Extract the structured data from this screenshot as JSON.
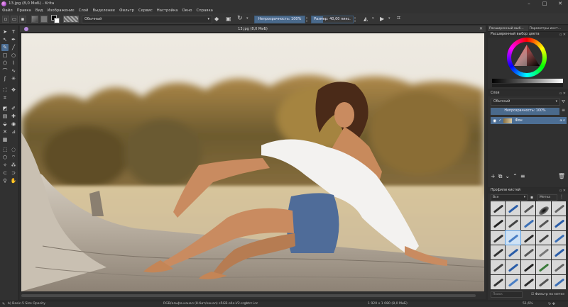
{
  "window": {
    "title": "13.jpg (8,0 МиБ) - Krita",
    "controls": [
      "–",
      "□",
      "✕"
    ]
  },
  "menu": [
    "Файл",
    "Правка",
    "Вид",
    "Изображение",
    "Слой",
    "Выделение",
    "Фильтр",
    "Сервис",
    "Настройка",
    "Окно",
    "Справка"
  ],
  "toolbar": {
    "blend_mode": "Обычный",
    "opacity_label": "Непрозрачность: 100%",
    "size_label": "Размер: 40,00 пикс.",
    "opacity_value": 1.0
  },
  "document": {
    "tab_title": "13.jpg (8,0 МиБ)",
    "close": "✕"
  },
  "dock": {
    "tabs": [
      "Расширенный выб...",
      "Параметры инст..."
    ],
    "color_panel_title": "Расширенный выбор цвета",
    "layers_title": "Слои",
    "layers_blend": "Обычный",
    "layers_opacity": "Непрозрачность: 100%",
    "layer_name": "Фон",
    "brush_panel_title": "Профили кистей",
    "brush_filter": "Все",
    "brush_tag": "Метка",
    "brush_search_placeholder": "Поиск",
    "brush_filter_check": "Фильтр по метке"
  },
  "status": {
    "brush": "b) Basic-5 Size Opacity",
    "colorspace": "RGB/альфа-канал (8-бит/канал) sRGB-elle-V2-srgbtrc.icc",
    "dimensions": "1 920 x 1 080 (8,0 МиБ)",
    "zoom": "51,6%"
  },
  "colors": {
    "accent": "#4d6f95",
    "panel": "#303030",
    "bg": "#2b2b2b"
  }
}
